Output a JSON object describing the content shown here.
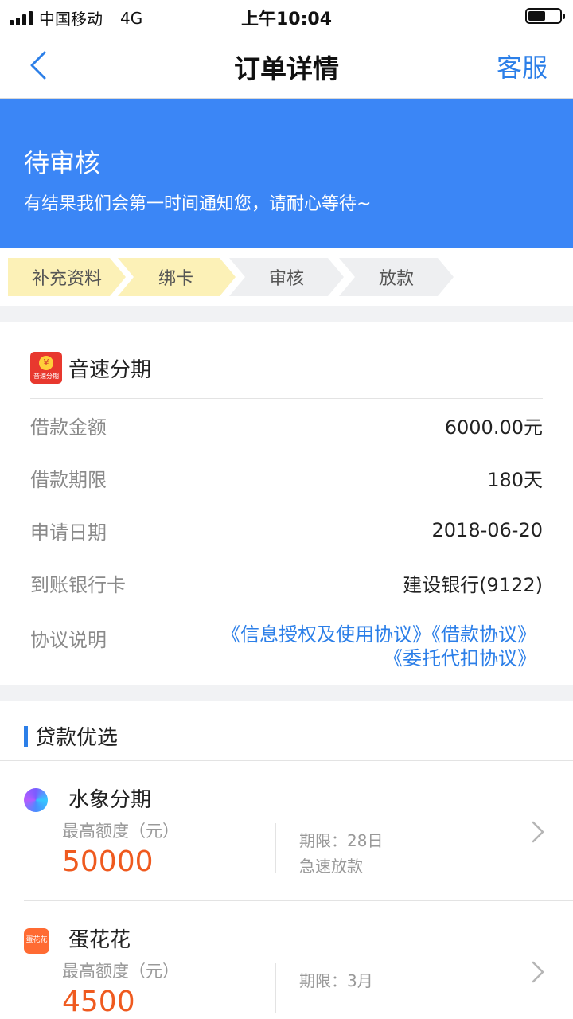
{
  "status_bar": {
    "carrier": "中国移动",
    "network": "4G",
    "time": "上午10:04",
    "battery_level": 0.55
  },
  "nav": {
    "title": "订单详情",
    "right_label": "客服"
  },
  "banner": {
    "title": "待审核",
    "subtitle": "有结果我们会第一时间通知您，请耐心等待~",
    "color": "#3b86f6"
  },
  "steps": [
    {
      "label": "补充资料",
      "state": "done"
    },
    {
      "label": "绑卡",
      "state": "done"
    },
    {
      "label": "审核",
      "state": "todo"
    },
    {
      "label": "放款",
      "state": "todo"
    }
  ],
  "order": {
    "brand_name": "音速分期",
    "brand_logo_text": "音速分期",
    "rows": [
      {
        "label": "借款金额",
        "value": "6000.00元"
      },
      {
        "label": "借款期限",
        "value": "180天"
      },
      {
        "label": "申请日期",
        "value": "2018-06-20"
      },
      {
        "label": "到账银行卡",
        "value": "建设银行(9122)"
      }
    ],
    "agreement_label": "协议说明",
    "agreements_line1": "《信息授权及使用协议》《借款协议》",
    "agreements_line2": "《委托代扣协议》"
  },
  "recommend": {
    "title": "贷款优选",
    "products": [
      {
        "name": "水象分期",
        "limit_label": "最高额度（元）",
        "amount": "50000",
        "term": "期限：28日",
        "tag": "急速放款",
        "icon": "water-logo-icon"
      },
      {
        "name": "蛋花花",
        "limit_label": "最高额度（元）",
        "amount": "4500",
        "term": "期限：3月",
        "tag": "",
        "icon_text": "蛋花花",
        "icon": "egg-logo-icon"
      }
    ]
  },
  "colors": {
    "accent": "#2c7fe8",
    "amount": "#ef5a1f",
    "step_done": "#fcf1b7",
    "step_todo": "#eeeff1"
  }
}
